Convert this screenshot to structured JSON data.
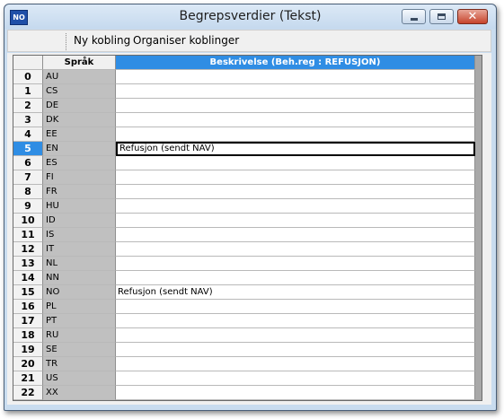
{
  "window": {
    "app_icon": "NO",
    "title": "Begrepsverdier (Tekst)"
  },
  "toolbar": {
    "new_link": "Ny kobling",
    "organize_links": "Organiser koblinger"
  },
  "grid": {
    "columns": {
      "row": "",
      "language": "Språk",
      "description": "Beskrivelse (Beh.reg : REFUSJON)"
    },
    "selected_row": 5,
    "rows": [
      {
        "n": "0",
        "lang": "AU",
        "desc": ""
      },
      {
        "n": "1",
        "lang": "CS",
        "desc": ""
      },
      {
        "n": "2",
        "lang": "DE",
        "desc": ""
      },
      {
        "n": "3",
        "lang": "DK",
        "desc": ""
      },
      {
        "n": "4",
        "lang": "EE",
        "desc": ""
      },
      {
        "n": "5",
        "lang": "EN",
        "desc": "Refusjon   (sendt NAV)"
      },
      {
        "n": "6",
        "lang": "ES",
        "desc": ""
      },
      {
        "n": "7",
        "lang": "FI",
        "desc": ""
      },
      {
        "n": "8",
        "lang": "FR",
        "desc": ""
      },
      {
        "n": "9",
        "lang": "HU",
        "desc": ""
      },
      {
        "n": "10",
        "lang": "ID",
        "desc": ""
      },
      {
        "n": "11",
        "lang": "IS",
        "desc": ""
      },
      {
        "n": "12",
        "lang": "IT",
        "desc": ""
      },
      {
        "n": "13",
        "lang": "NL",
        "desc": ""
      },
      {
        "n": "14",
        "lang": "NN",
        "desc": ""
      },
      {
        "n": "15",
        "lang": "NO",
        "desc": "Refusjon   (sendt NAV)"
      },
      {
        "n": "16",
        "lang": "PL",
        "desc": ""
      },
      {
        "n": "17",
        "lang": "PT",
        "desc": ""
      },
      {
        "n": "18",
        "lang": "RU",
        "desc": ""
      },
      {
        "n": "19",
        "lang": "SE",
        "desc": ""
      },
      {
        "n": "20",
        "lang": "TR",
        "desc": ""
      },
      {
        "n": "21",
        "lang": "US",
        "desc": ""
      },
      {
        "n": "22",
        "lang": "XX",
        "desc": ""
      }
    ]
  },
  "colors": {
    "selection": "#2f8de4",
    "header_active": "#2f8de4",
    "language_column": "#c0c0c0"
  }
}
